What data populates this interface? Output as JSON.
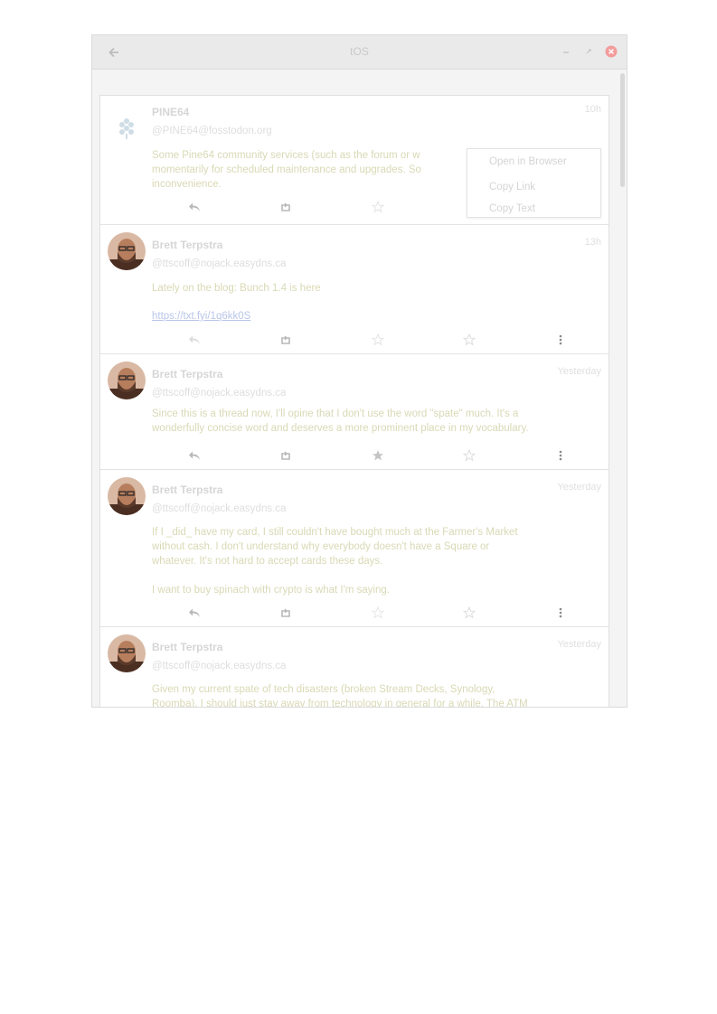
{
  "window": {
    "title": "tOS"
  },
  "posts": [
    {
      "name": "PINE64",
      "handle": "@PINE64@fosstodon.org",
      "time": "10h",
      "text": "Some Pine64 community services (such as the forum or w... momentarily for scheduled maintenance and upgrades. So... inconvenience.",
      "lines": [
        "Some Pine64 community services (such as the forum or w",
        "momentarily for scheduled maintenance and upgrades. So",
        "inconvenience."
      ]
    },
    {
      "name": "Brett Terpstra",
      "handle": "@ttscoff@nojack.easydns.ca",
      "time": "13h",
      "lines": [
        "Lately on the blog: Bunch 1.4 is here"
      ],
      "link": "https://txt.fyi/1q6kk0S"
    },
    {
      "name": "Brett Terpstra",
      "handle": "@ttscoff@nojack.easydns.ca",
      "time": "Yesterday",
      "lines": [
        "Since this is a thread now, I'll opine that I don't use the word \"spate\" much. It's a",
        "wonderfully concise word and deserves a more prominent place in my vocabulary."
      ]
    },
    {
      "name": "Brett Terpstra",
      "handle": "@ttscoff@nojack.easydns.ca",
      "time": "Yesterday",
      "lines": [
        "If I _did_ have my card, I still couldn't have bought much at the Farmer's Market",
        "without cash. I don't understand why everybody doesn't have a Square or",
        "whatever. It's not hard to accept cards these days.",
        "",
        "I want to buy spinach with crypto is what I'm saying."
      ]
    },
    {
      "name": "Brett Terpstra",
      "handle": "@ttscoff@nojack.easydns.ca",
      "time": "Yesterday",
      "lines": [
        "Given my current spate of tech disasters (broken Stream Decks, Synology,",
        "Roomba), I should just stay away from technology in general for a while. The ATM"
      ]
    }
  ],
  "context_menu": {
    "items": [
      "Open in Browser",
      "Copy Link",
      "Copy Text"
    ]
  },
  "colors": {
    "window_bg": "#f4f4f4",
    "text": "#d9d9b6",
    "link": "#b9c6ea",
    "close": "#f29c9c"
  }
}
